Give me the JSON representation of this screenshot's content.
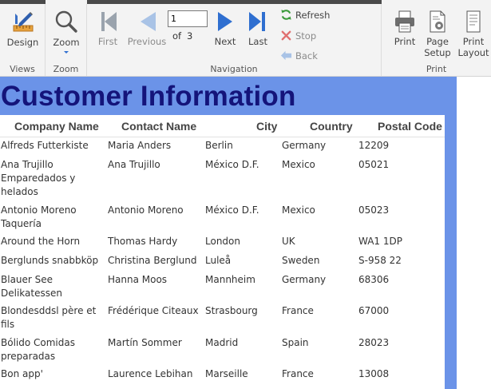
{
  "ribbon": {
    "groups": {
      "views": "Views",
      "zoom": "Zoom",
      "navigation": "Navigation",
      "print": "Print"
    },
    "design_label": "Design",
    "zoom_label": "Zoom",
    "first_label": "First",
    "previous_label": "Previous",
    "next_label": "Next",
    "last_label": "Last",
    "page_number": "1",
    "of_label": "of",
    "page_count": "3",
    "refresh_label": "Refresh",
    "stop_label": "Stop",
    "back_label": "Back",
    "print_label": "Print",
    "page_setup_label_1": "Page",
    "page_setup_label_2": "Setup",
    "print_layout_label_1": "Print",
    "print_layout_label_2": "Layout"
  },
  "report": {
    "title": "Customer Information",
    "columns": {
      "company": "Company Name",
      "contact": "Contact Name",
      "city": "City",
      "country": "Country",
      "postal": "Postal Code"
    },
    "rows": [
      {
        "company": "Alfreds Futterkiste",
        "contact": "Maria Anders",
        "city": "Berlin",
        "country": "Germany",
        "postal": "12209"
      },
      {
        "company": "Ana Trujillo Emparedados y helados",
        "contact": "Ana Trujillo",
        "city": "México D.F.",
        "country": "Mexico",
        "postal": "05021"
      },
      {
        "company": "Antonio Moreno Taquería",
        "contact": "Antonio Moreno",
        "city": "México D.F.",
        "country": "Mexico",
        "postal": "05023"
      },
      {
        "company": "Around the Horn",
        "contact": "Thomas Hardy",
        "city": "London",
        "country": "UK",
        "postal": "WA1 1DP"
      },
      {
        "company": "Berglunds snabbköp",
        "contact": "Christina Berglund",
        "city": "Luleå",
        "country": "Sweden",
        "postal": "S-958 22"
      },
      {
        "company": "Blauer See Delikatessen",
        "contact": "Hanna Moos",
        "city": "Mannheim",
        "country": "Germany",
        "postal": "68306"
      },
      {
        "company": "Blondesddsl père et fils",
        "contact": "Frédérique Citeaux",
        "city": "Strasbourg",
        "country": "France",
        "postal": "67000"
      },
      {
        "company": "Bólido Comidas preparadas",
        "contact": "Martín Sommer",
        "city": "Madrid",
        "country": "Spain",
        "postal": "28023"
      },
      {
        "company": "Bon app'",
        "contact": "Laurence Lebihan",
        "city": "Marseille",
        "country": "France",
        "postal": "13008"
      }
    ]
  }
}
